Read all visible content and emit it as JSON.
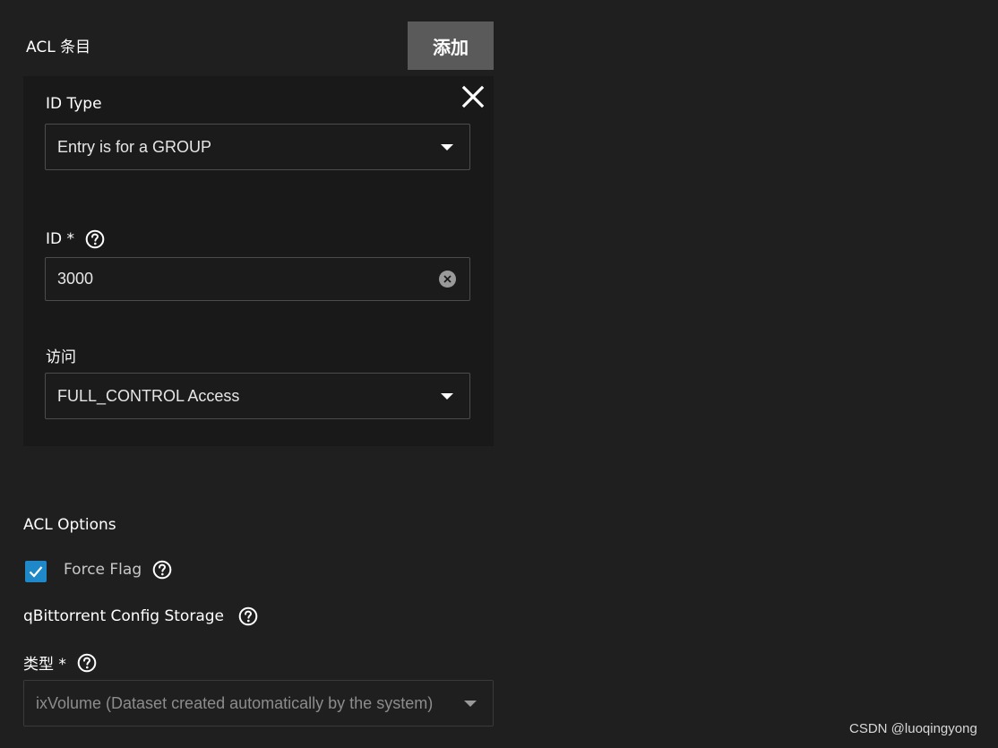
{
  "acl_entries": {
    "title": "ACL 条目",
    "add_label": "添加"
  },
  "entry": {
    "id_type": {
      "label": "ID Type",
      "value": "Entry is for a GROUP"
    },
    "id": {
      "label": "ID *",
      "value": "3000"
    },
    "access": {
      "label": "访问",
      "value": "FULL_CONTROL Access"
    }
  },
  "acl_options": {
    "title": "ACL Options",
    "force_flag": {
      "label": "Force Flag",
      "checked": true
    }
  },
  "storage": {
    "title": "qBittorrent Config Storage",
    "type": {
      "label": "类型 *",
      "value": "ixVolume (Dataset created automatically by the system)"
    }
  },
  "watermark": "CSDN @luoqingyong",
  "colors": {
    "background": "#1f1f1f",
    "card": "#191919",
    "accent_checkbox": "#1e88c8",
    "button": "#5a5a5a"
  }
}
